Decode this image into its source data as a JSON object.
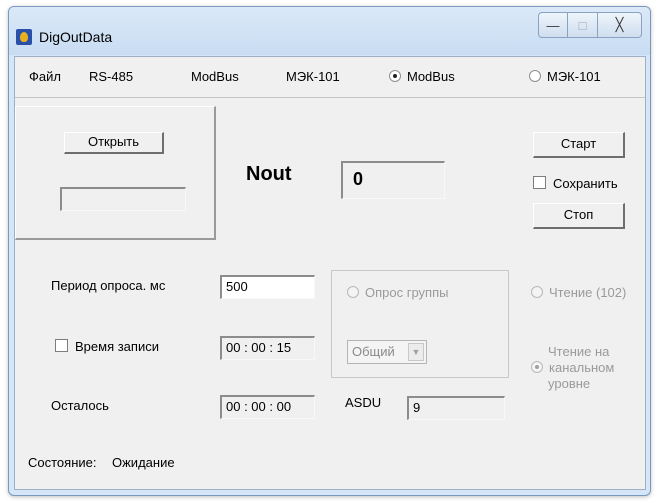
{
  "window": {
    "title": "DigOutData"
  },
  "caption": {
    "minimize": "—",
    "maximize": "□",
    "close": "╳"
  },
  "menu": {
    "file": "Файл",
    "rs485": "RS-485",
    "modbus": "ModBus",
    "mek101": "МЭК-101"
  },
  "protocol": {
    "modbus_label": "ModBus",
    "mek101_label": "МЭК-101",
    "selected": "ModBus"
  },
  "panel": {
    "open_label": "Открыть",
    "file_value": ""
  },
  "nout": {
    "label": "Nout",
    "value": "0"
  },
  "controls": {
    "start_label": "Старт",
    "save_label": "Сохранить",
    "save_checked": false,
    "stop_label": "Стоп"
  },
  "poll": {
    "period_label": "Период опроса. мс",
    "period_value": "500"
  },
  "record": {
    "label": "Время записи",
    "checked": false,
    "value": "00 : 00 : 15"
  },
  "remaining": {
    "label": "Осталось",
    "value": "00 : 00 : 00"
  },
  "group": {
    "poll_label": "Опрос группы",
    "combo_value": "Общий"
  },
  "asdu": {
    "label": "ASDU",
    "value": "9"
  },
  "read": {
    "read102_label": "Чтение (102)",
    "channel_label_1": "Чтение на",
    "channel_label_2": "канальном",
    "channel_label_3": "уровне"
  },
  "status": {
    "label": "Состояние:",
    "value": "Ожидание"
  }
}
